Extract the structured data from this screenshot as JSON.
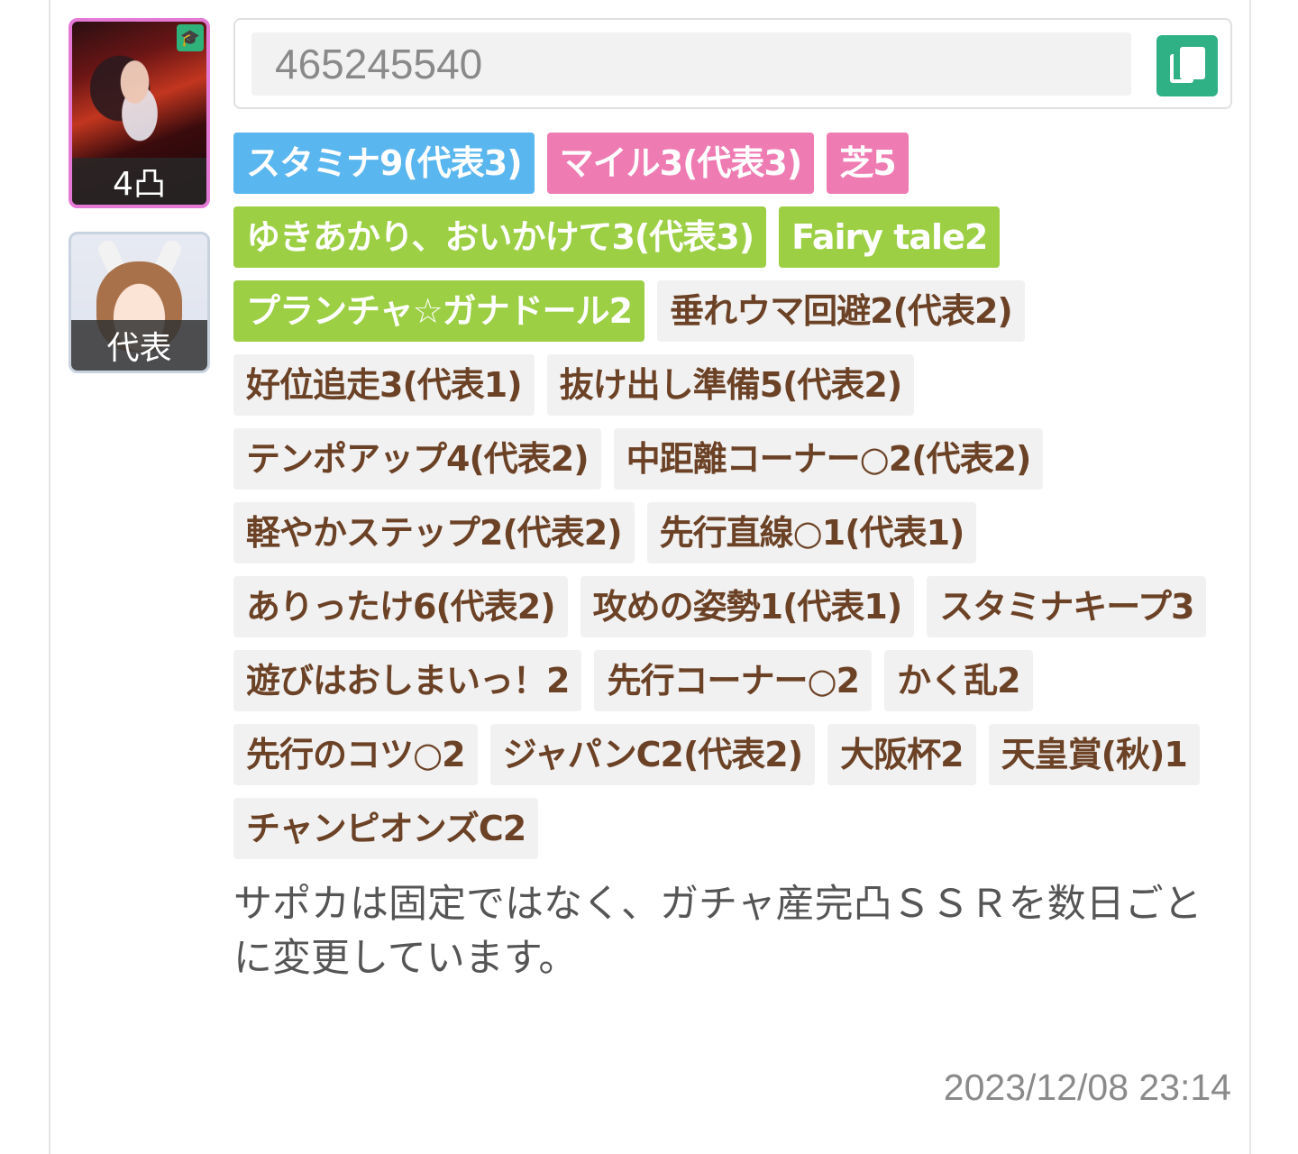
{
  "support_card": {
    "limit_break": "4凸"
  },
  "character": {
    "label": "代表"
  },
  "friend_id": {
    "value": "465245540"
  },
  "tags": [
    {
      "text": "スタミナ9(代表3)",
      "color": "blue"
    },
    {
      "text": "マイル3(代表3)",
      "color": "pink"
    },
    {
      "text": "芝5",
      "color": "pink"
    },
    {
      "text": "ゆきあかり、おいかけて3(代表3)",
      "color": "green"
    },
    {
      "text": "Fairy tale2",
      "color": "green"
    },
    {
      "text": "プランチャ☆ガナドール2",
      "color": "green"
    },
    {
      "text": "垂れウマ回避2(代表2)",
      "color": "gray"
    },
    {
      "text": "好位追走3(代表1)",
      "color": "gray"
    },
    {
      "text": "抜け出し準備5(代表2)",
      "color": "gray"
    },
    {
      "text": "テンポアップ4(代表2)",
      "color": "gray"
    },
    {
      "text": "中距離コーナー○2(代表2)",
      "color": "gray"
    },
    {
      "text": "軽やかステップ2(代表2)",
      "color": "gray"
    },
    {
      "text": "先行直線○1(代表1)",
      "color": "gray"
    },
    {
      "text": "ありったけ6(代表2)",
      "color": "gray"
    },
    {
      "text": "攻めの姿勢1(代表1)",
      "color": "gray"
    },
    {
      "text": "スタミナキープ3",
      "color": "gray"
    },
    {
      "text": "遊びはおしまいっ！2",
      "color": "gray"
    },
    {
      "text": "先行コーナー○2",
      "color": "gray"
    },
    {
      "text": "かく乱2",
      "color": "gray"
    },
    {
      "text": "先行のコツ○2",
      "color": "gray"
    },
    {
      "text": "ジャパンC2(代表2)",
      "color": "gray"
    },
    {
      "text": "大阪杯2",
      "color": "gray"
    },
    {
      "text": "天皇賞(秋)1",
      "color": "gray"
    },
    {
      "text": "チャンピオンズC2",
      "color": "gray"
    }
  ],
  "comment": "サポカは固定ではなく、ガチャ産完凸ＳＳＲを数日ごとに変更しています。",
  "timestamp": "2023/12/08 23:14"
}
